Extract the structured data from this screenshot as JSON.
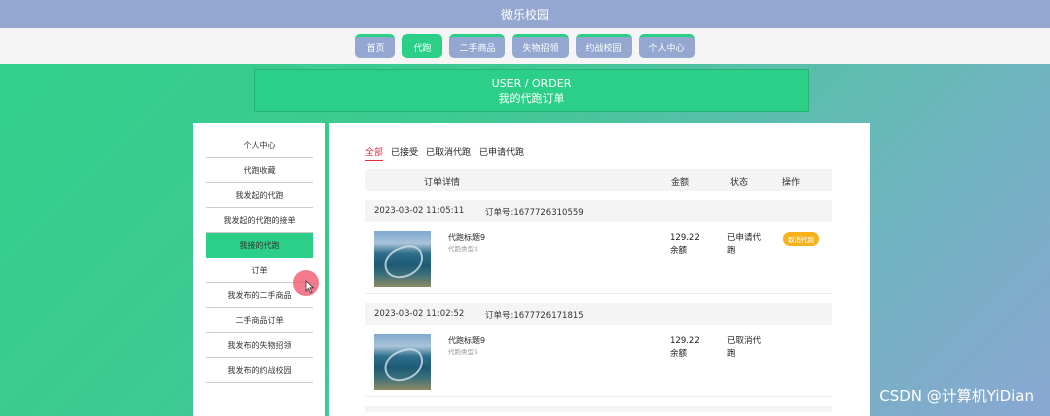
{
  "app": {
    "title": "微乐校园"
  },
  "nav": {
    "tabs": [
      {
        "label": "首页"
      },
      {
        "label": "代跑"
      },
      {
        "label": "二手商品"
      },
      {
        "label": "失物招领"
      },
      {
        "label": "约战校园"
      },
      {
        "label": "个人中心"
      }
    ],
    "active_tab": "代跑"
  },
  "banner": {
    "line1": "USER / ORDER",
    "line2": "我的代跑订单"
  },
  "sidebar": {
    "items": [
      {
        "label": "个人中心"
      },
      {
        "label": "代跑收藏"
      },
      {
        "label": "我发起的代跑"
      },
      {
        "label": "我发起的代跑的接单"
      },
      {
        "label": "我接的代跑"
      },
      {
        "label": "订单"
      },
      {
        "label": "我发布的二手商品"
      },
      {
        "label": "二手商品订单"
      },
      {
        "label": "我发布的失物招领"
      },
      {
        "label": "我发布的约战校园"
      }
    ],
    "active_item": "我接的代跑"
  },
  "filters": [
    "全部",
    "已接受",
    "已取消代跑",
    "已申请代跑"
  ],
  "active_filter": "全部",
  "table": {
    "headers": {
      "detail": "订单详情",
      "amount": "金额",
      "status": "状态",
      "action": "操作"
    }
  },
  "orders": [
    {
      "time": "2023-03-02 11:05:11",
      "order_no_label": "订单号:1677726310559",
      "title": "代跑标题9",
      "subtitle": "代跑类型1",
      "amount": "129.22",
      "payment": "余额",
      "status": "已申请代跑",
      "action": "取消代跑"
    },
    {
      "time": "2023-03-02 11:02:52",
      "order_no_label": "订单号:1677726171815",
      "title": "代跑标题9",
      "subtitle": "代跑类型1",
      "amount": "129.22",
      "payment": "余额",
      "status": "已取消代跑",
      "action": ""
    }
  ],
  "watermark": "CSDN @计算机YiDian",
  "colors": {
    "accent": "#2ccf88",
    "nav": "#94a7d1",
    "warning": "#f5b21a",
    "active_filter": "#e0303c"
  }
}
